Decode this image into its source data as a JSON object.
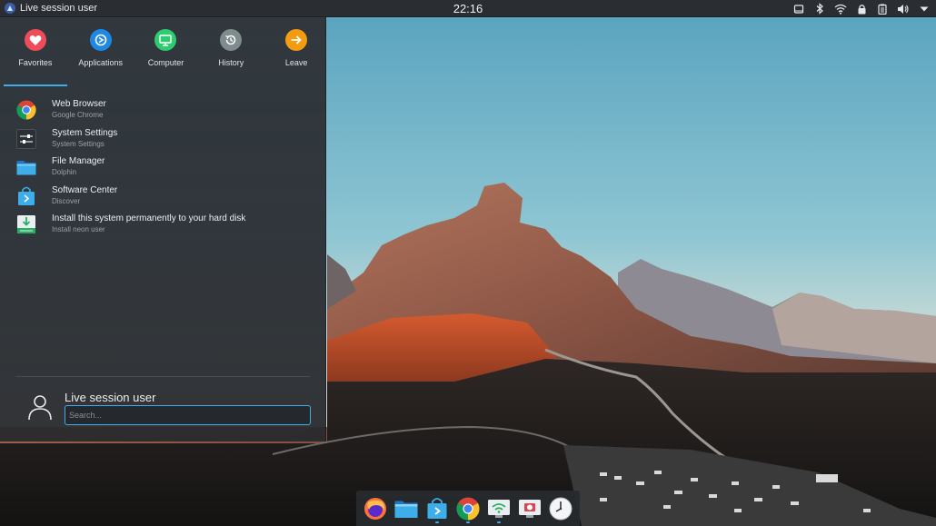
{
  "top_panel": {
    "window_title": "Live session user",
    "clock": "22:16",
    "tray_icons": [
      "storage-icon",
      "bluetooth-icon",
      "wifi-icon",
      "lock-icon",
      "clipboard-icon",
      "volume-icon",
      "menu-arrow-icon"
    ]
  },
  "menu": {
    "categories": [
      {
        "label": "Favorites",
        "icon": "heart-icon",
        "color": "#ef4b5a",
        "active": true
      },
      {
        "label": "Applications",
        "icon": "applications-icon",
        "color": "#1e88e5",
        "active": false
      },
      {
        "label": "Computer",
        "icon": "computer-icon",
        "color": "#2ecc71",
        "active": false
      },
      {
        "label": "History",
        "icon": "history-icon",
        "color": "#7f8c8d",
        "active": false
      },
      {
        "label": "Leave",
        "icon": "leave-icon",
        "color": "#f39c12",
        "active": false
      }
    ],
    "apps": [
      {
        "name": "Web Browser",
        "sub": "Google Chrome",
        "icon": "chrome-icon"
      },
      {
        "name": "System Settings",
        "sub": "System Settings",
        "icon": "settings-icon"
      },
      {
        "name": "File Manager",
        "sub": "Dolphin",
        "icon": "folder-icon"
      },
      {
        "name": "Software Center",
        "sub": "Discover",
        "icon": "discover-icon"
      },
      {
        "name": "Install this system permanently to your hard disk",
        "sub": "Install neon user",
        "icon": "installer-icon"
      }
    ],
    "user_name": "Live session user",
    "search_placeholder": "Search..."
  },
  "dock": {
    "items": [
      "firefox-icon",
      "dolphin-icon",
      "discover-icon",
      "chrome-icon",
      "network-icon",
      "screenshot-icon",
      "clock-icon"
    ]
  },
  "colors": {
    "accent": "#3daee9",
    "panel": "#2a2e32"
  }
}
